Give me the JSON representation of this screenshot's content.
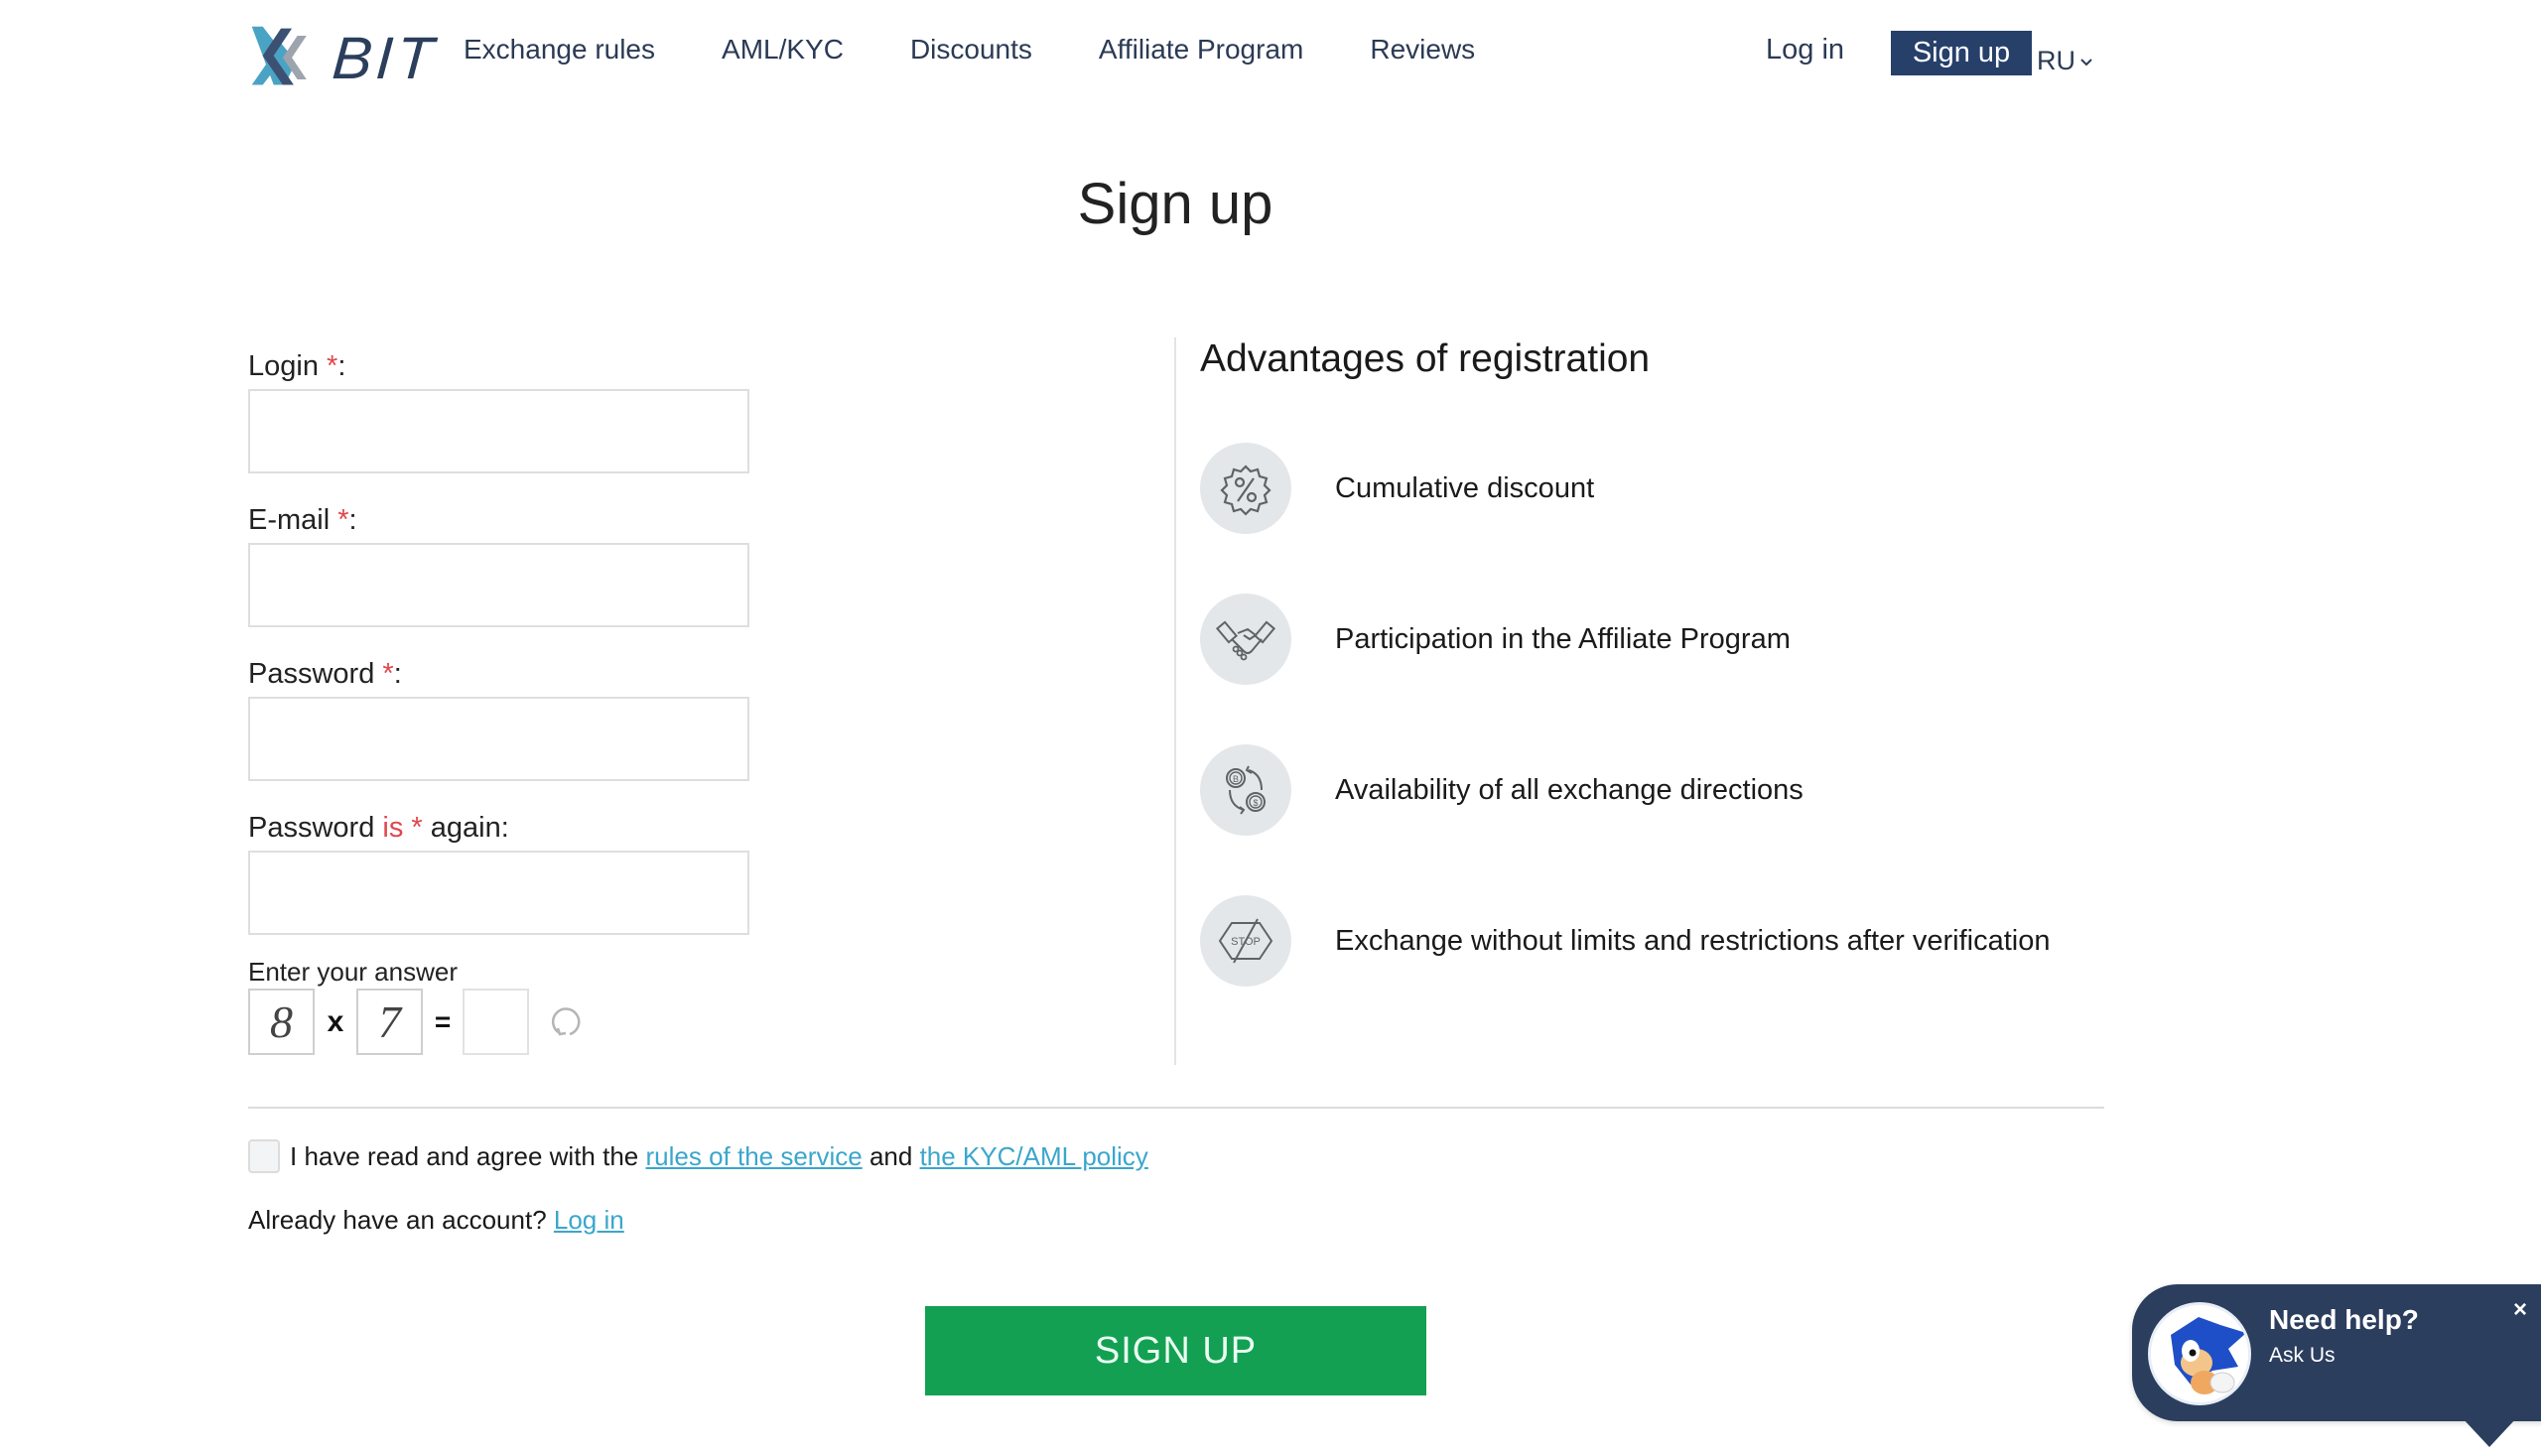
{
  "header": {
    "logo_text": "BIT",
    "nav": [
      "Exchange rules",
      "AML/KYC",
      "Discounts",
      "Affiliate Program",
      "Reviews"
    ],
    "login_label": "Log in",
    "signup_label": "Sign up",
    "language": "RU",
    "language_chevron": "⌄"
  },
  "page": {
    "title": "Sign up"
  },
  "form": {
    "fields": [
      {
        "label": "Login",
        "required_mark": "*",
        "suffix": ":",
        "value": ""
      },
      {
        "label": "E-mail",
        "required_mark": "*",
        "suffix": ":",
        "value": ""
      },
      {
        "label": "Password",
        "required_mark": "*",
        "suffix": ":",
        "value": ""
      }
    ],
    "confirm": {
      "label_start": "Password",
      "label_red": "is",
      "required_mark": "*",
      "label_end": "again:",
      "value": ""
    },
    "captcha": {
      "label": "Enter your answer",
      "operand1": "8",
      "operator": "x",
      "operand2": "7",
      "equals": "=",
      "answer": ""
    }
  },
  "advantages": {
    "title": "Advantages of registration",
    "items": [
      {
        "icon": "discount-badge-icon",
        "text": "Cumulative discount"
      },
      {
        "icon": "handshake-icon",
        "text": "Participation in the Affiliate Program"
      },
      {
        "icon": "exchange-coins-icon",
        "text": "Availability of all exchange directions"
      },
      {
        "icon": "no-stop-sign-icon",
        "text": "Exchange without limits and restrictions after verification"
      }
    ]
  },
  "agreement": {
    "checked": false,
    "text_start": "I have read and agree with the",
    "link1": "rules of the service",
    "text_mid": "and",
    "link2": "the KYC/AML policy"
  },
  "already": {
    "text": "Already have an account?",
    "link": "Log in"
  },
  "submit_label": "SIGN UP",
  "help_widget": {
    "title": "Need help?",
    "subtitle": "Ask Us",
    "close": "×"
  },
  "colors": {
    "brand_navy": "#26406a",
    "required_red": "#e0474c",
    "link_blue": "#3ba6cc",
    "submit_green": "#13a052",
    "widget_bg": "#2b3e5e"
  }
}
